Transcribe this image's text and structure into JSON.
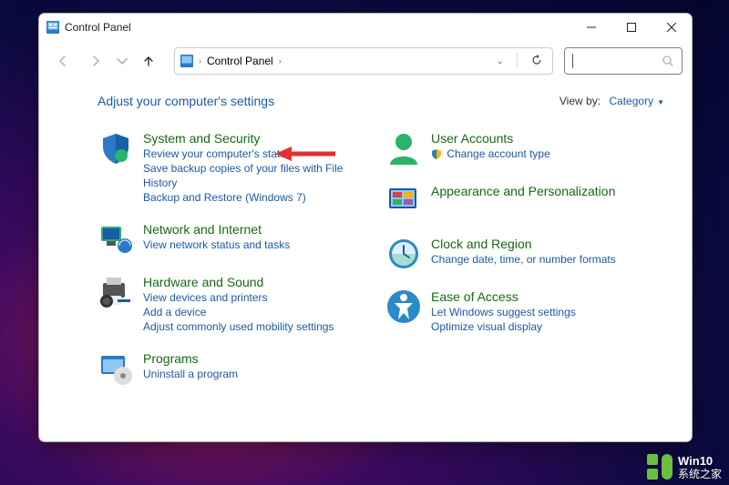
{
  "titlebar": {
    "title": "Control Panel"
  },
  "nav": {
    "breadcrumb": [
      {
        "icon": "cp",
        "label": ""
      },
      {
        "label": "Control Panel"
      }
    ]
  },
  "header": {
    "heading": "Adjust your computer's settings",
    "viewby_label": "View by:",
    "viewby_mode": "Category"
  },
  "categories_left": [
    {
      "id": "system-security",
      "icon": "shield",
      "title": "System and Security",
      "links": [
        "Review your computer's status",
        "Save backup copies of your files with File History",
        "Backup and Restore (Windows 7)"
      ]
    },
    {
      "id": "network",
      "icon": "network",
      "title": "Network and Internet",
      "links": [
        "View network status and tasks"
      ]
    },
    {
      "id": "hardware",
      "icon": "printer",
      "title": "Hardware and Sound",
      "links": [
        "View devices and printers",
        "Add a device",
        "Adjust commonly used mobility settings"
      ]
    },
    {
      "id": "programs",
      "icon": "programs",
      "title": "Programs",
      "links": [
        "Uninstall a program"
      ]
    }
  ],
  "categories_right": [
    {
      "id": "user-accounts",
      "icon": "user",
      "title": "User Accounts",
      "links": [
        {
          "shield": true,
          "text": "Change account type"
        }
      ]
    },
    {
      "id": "appearance",
      "icon": "appearance",
      "title": "Appearance and Personalization",
      "links": []
    },
    {
      "id": "clock",
      "icon": "clock",
      "title": "Clock and Region",
      "links": [
        "Change date, time, or number formats"
      ]
    },
    {
      "id": "ease",
      "icon": "ease",
      "title": "Ease of Access",
      "links": [
        "Let Windows suggest settings",
        "Optimize visual display"
      ]
    }
  ],
  "watermark": {
    "line1": "Win10",
    "line2": "系统之家"
  }
}
